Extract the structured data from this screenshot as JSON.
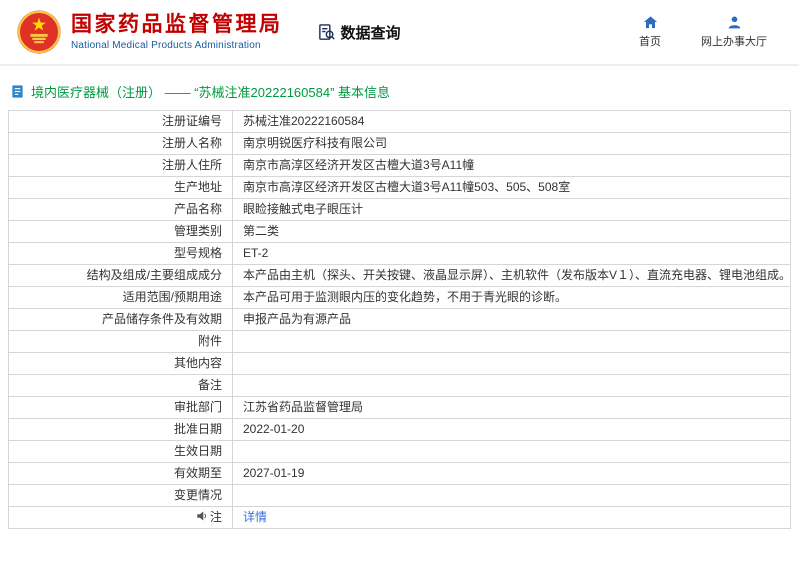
{
  "header": {
    "org_name_cn": "国家药品监督管理局",
    "org_name_en": "National Medical Products Administration",
    "data_query_label": "数据查询",
    "home_label": "首页",
    "service_hall_label": "网上办事大厅"
  },
  "colors": {
    "brand_red": "#c30000",
    "brand_blue": "#1a5aa6",
    "title_green": "#009940",
    "link_blue": "#3a6fd8",
    "icon_blue": "#2e6dbd"
  },
  "page": {
    "title": "境内医疗器械（注册） —— “苏械注准20222160584” 基本信息"
  },
  "table": {
    "rows": [
      {
        "label": "注册证编号",
        "value": "苏械注准20222160584"
      },
      {
        "label": "注册人名称",
        "value": "南京明锐医疗科技有限公司"
      },
      {
        "label": "注册人住所",
        "value": "南京市高淳区经济开发区古檀大道3号A11幢"
      },
      {
        "label": "生产地址",
        "value": "南京市高淳区经济开发区古檀大道3号A11幢503、505、508室"
      },
      {
        "label": "产品名称",
        "value": "眼睑接触式电子眼压计"
      },
      {
        "label": "管理类别",
        "value": "第二类"
      },
      {
        "label": "型号规格",
        "value": "ET-2"
      },
      {
        "label": "结构及组成/主要组成成分",
        "value": "本产品由主机（探头、开关按键、液晶显示屏）、主机软件（发布版本V１）、直流充电器、锂电池组成。"
      },
      {
        "label": "适用范围/预期用途",
        "value": "本产品可用于监测眼内压的变化趋势，不用于青光眼的诊断。"
      },
      {
        "label": "产品储存条件及有效期",
        "value": "申报产品为有源产品"
      },
      {
        "label": "附件",
        "value": ""
      },
      {
        "label": "其他内容",
        "value": ""
      },
      {
        "label": "备注",
        "value": ""
      },
      {
        "label": "审批部门",
        "value": "江苏省药品监督管理局"
      },
      {
        "label": "批准日期",
        "value": "2022-01-20"
      },
      {
        "label": "生效日期",
        "value": ""
      },
      {
        "label": "有效期至",
        "value": "2027-01-19"
      },
      {
        "label": "变更情况",
        "value": ""
      },
      {
        "label": "注",
        "value": "详情"
      }
    ]
  }
}
